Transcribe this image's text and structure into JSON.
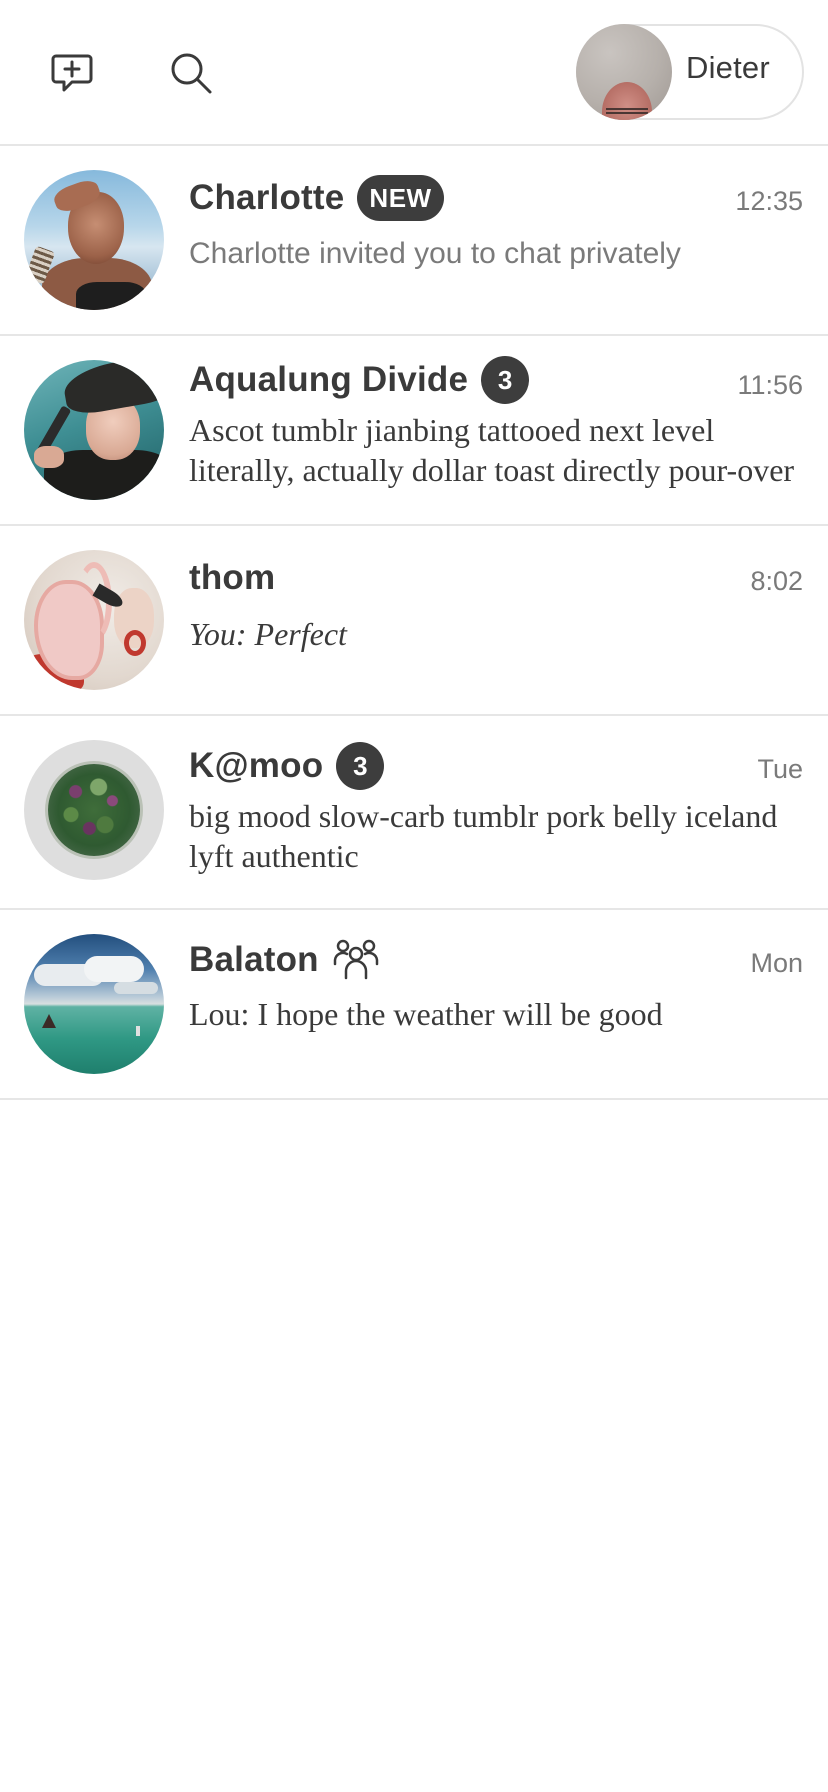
{
  "header": {
    "new_chat_icon": "new-chat-icon",
    "search_icon": "search-icon",
    "profile_name": "Dieter"
  },
  "conversations": [
    {
      "name": "Charlotte",
      "badge": "NEW",
      "time": "12:35",
      "preview": "Charlotte invited you to chat privately",
      "preview_style": "sans-muted"
    },
    {
      "name": "Aqualung Divide",
      "badge_count": "3",
      "time": "11:56",
      "preview": "Ascot tumblr jianbing tattooed next level literally, actually dollar toast directly pour-over",
      "preview_style": "serif"
    },
    {
      "name": "thom",
      "time": "8:02",
      "preview": "You: Perfect",
      "preview_style": "serif-italic"
    },
    {
      "name": "K@moo",
      "badge_count": "3",
      "time": "Tue",
      "preview": "big mood slow-carb tumblr pork belly iceland lyft authentic",
      "preview_style": "serif"
    },
    {
      "name": "Balaton",
      "group_icon": "group-icon",
      "time": "Mon",
      "preview": "Lou: I hope the weather will be good",
      "preview_style": "serif"
    }
  ],
  "colors": {
    "text_primary": "#3a3a3a",
    "text_muted": "#7a7a7a",
    "badge_bg": "#3d3d3d",
    "divider": "#e6e6e6"
  }
}
